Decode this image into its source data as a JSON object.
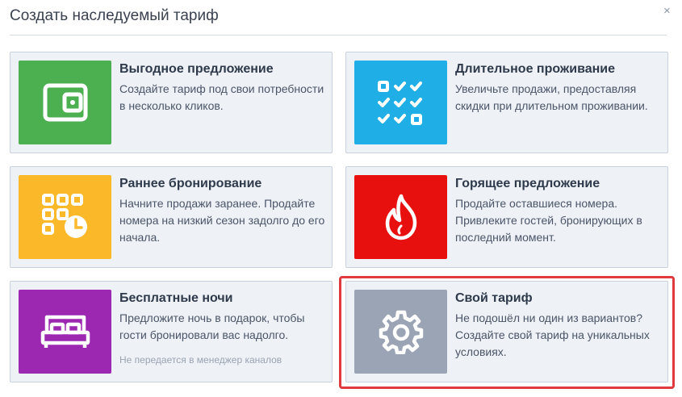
{
  "dialog": {
    "title": "Создать наследуемый тариф",
    "close_glyph": "×"
  },
  "cards": [
    {
      "title": "Выгодное предложение",
      "description": "Создайте тариф под свои потребности в несколько кликов.",
      "icon": "wallet-icon",
      "color": "#4caf50"
    },
    {
      "title": "Длительное проживание",
      "description": "Увеличьте продажи, предоставляя скидки при длительном проживании.",
      "icon": "checklist-icon",
      "color": "#1faee6"
    },
    {
      "title": "Раннее бронирование",
      "description": "Начните продажи заранее. Продайте номера на низкий сезон задолго до его начала.",
      "icon": "calendar-clock-icon",
      "color": "#fbb829"
    },
    {
      "title": "Горящее предложение",
      "description": "Продайте оставшиеся номера. Привлеките гостей, бронирующих в последний момент.",
      "icon": "flame-icon",
      "color": "#e80f0f"
    },
    {
      "title": "Бесплатные ночи",
      "description": "Предложите ночь в подарок, чтобы гости бронировали вас надолго.",
      "note": "Не передается в менеджер каналов",
      "icon": "bed-icon",
      "color": "#9c27b0"
    },
    {
      "title": "Свой тариф",
      "description": "Не подошёл ни один из вариантов? Создайте свой тариф на уникальных условиях.",
      "icon": "gear-icon",
      "color": "#9aa4b5",
      "selected": true
    }
  ]
}
